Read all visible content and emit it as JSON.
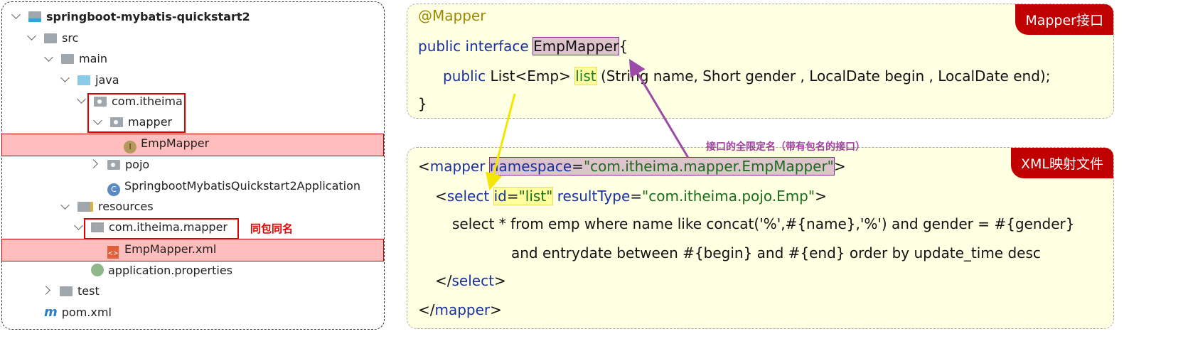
{
  "tree": {
    "items": [
      {
        "label": "springboot-mybatis-quickstart2",
        "icon": "project-folder-icon",
        "expanded": true
      },
      {
        "label": "src",
        "icon": "folder-icon",
        "expanded": true
      },
      {
        "label": "main",
        "icon": "folder-icon",
        "expanded": true
      },
      {
        "label": "java",
        "icon": "source-folder-icon",
        "expanded": true
      },
      {
        "label": "com.itheima",
        "icon": "package-icon",
        "expanded": true
      },
      {
        "label": "mapper",
        "icon": "package-icon",
        "expanded": true
      },
      {
        "label": "EmpMapper",
        "icon": "interface-icon"
      },
      {
        "label": "pojo",
        "icon": "package-icon",
        "expanded": false
      },
      {
        "label": "SpringbootMybatisQuickstart2Application",
        "icon": "spring-class-icon"
      },
      {
        "label": "resources",
        "icon": "resources-folder-icon",
        "expanded": true
      },
      {
        "label": "com.itheima.mapper",
        "icon": "folder-icon",
        "expanded": true
      },
      {
        "label": "EmpMapper.xml",
        "icon": "xml-file-icon"
      },
      {
        "label": "application.properties",
        "icon": "properties-icon"
      },
      {
        "label": "test",
        "icon": "folder-icon",
        "expanded": false
      },
      {
        "label": "pom.xml",
        "icon": "maven-icon"
      }
    ],
    "same_package_note": "同包同名"
  },
  "mapper_box": {
    "tag": "Mapper接口",
    "annotation": "@Mapper",
    "kw_public_interface": "public interface",
    "name": "EmpMapper",
    "brace_open": "{",
    "kw_public": "public",
    "ret": "List<Emp>",
    "method": "list",
    "params": "(String name, Short gender , LocalDate begin , LocalDate end);",
    "brace_close": "}"
  },
  "xml_box": {
    "tag": "XML映射文件",
    "l1_open": "<",
    "l1_tag": "mapper",
    "l1_attr": "namespace",
    "l1_eq": "=",
    "l1_val": "\"com.itheima.mapper.EmpMapper\"",
    "l1_close": ">",
    "l2_open": "<",
    "l2_tag": "select",
    "l2_attr": "id",
    "l2_eq": "=",
    "l2_val": "\"list\"",
    "l2_attr2": "resultType",
    "l2_val2": "\"com.itheima.pojo.Emp\"",
    "l2_close": ">",
    "sql1": "select * from emp where name like concat('%',#{name},'%') and gender = #{gender}",
    "sql2": "and entrydate between #{begin} and #{end} order by update_time desc",
    "l5_open": "</",
    "l5_tag": "select",
    "l5_close": ">",
    "l6_open": "</",
    "l6_tag": "mapper",
    "l6_close": ">"
  },
  "annotation_note": "接口的全限定名（带有包名的接口）",
  "colors": {
    "highlight_red": "#ffbdbd",
    "tag_red": "#c00000",
    "code_bg": "#ffffe1",
    "arrow_purple": "#9b4aa5",
    "arrow_yellow": "#f5e600"
  }
}
